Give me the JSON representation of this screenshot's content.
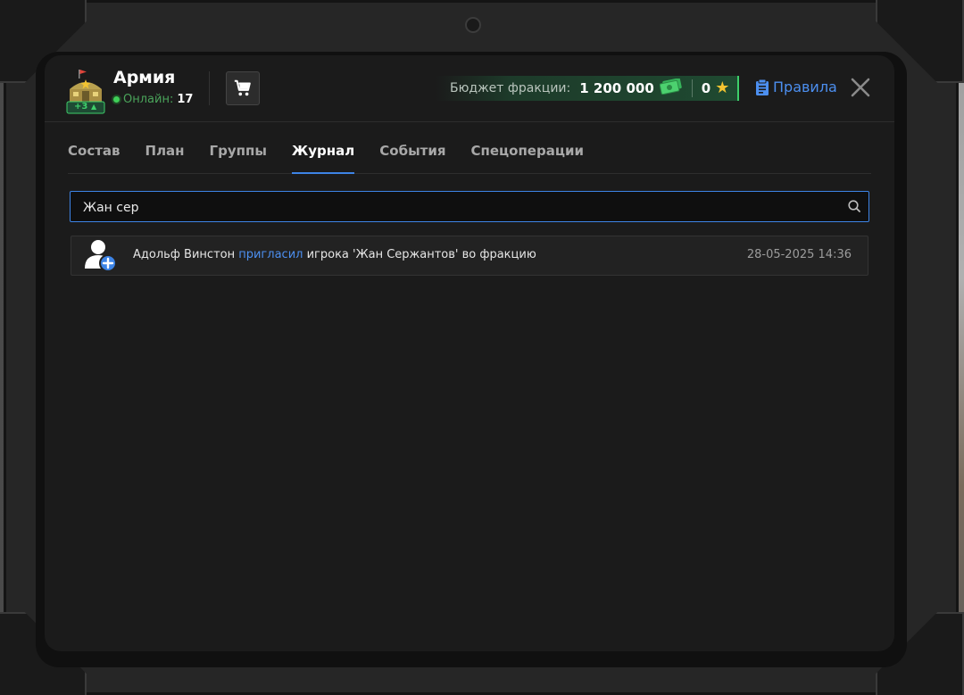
{
  "header": {
    "faction_name": "Армия",
    "faction_badge": "+3",
    "online_label": "Онлайн:",
    "online_count": "17",
    "budget_label": "Бюджет фракции:",
    "budget_value": "1 200 000",
    "stars_value": "0",
    "rules_label": "Правила"
  },
  "tabs": [
    {
      "label": "Состав",
      "active": false
    },
    {
      "label": "План",
      "active": false
    },
    {
      "label": "Группы",
      "active": false
    },
    {
      "label": "Журнал",
      "active": true
    },
    {
      "label": "События",
      "active": false
    },
    {
      "label": "Спецоперации",
      "active": false
    }
  ],
  "search": {
    "value": "Жан сер"
  },
  "log": [
    {
      "actor": "Адольф Винстон",
      "action": "пригласил",
      "details": "игрока 'Жан Сержантов' во фракцию",
      "timestamp": "28-05-2025 14:36",
      "icon": "user-invite-icon"
    }
  ],
  "colors": {
    "accent": "#3d84e6",
    "online": "#3fcf58",
    "budget_border": "#3ecf6a",
    "star": "#f3c431"
  }
}
